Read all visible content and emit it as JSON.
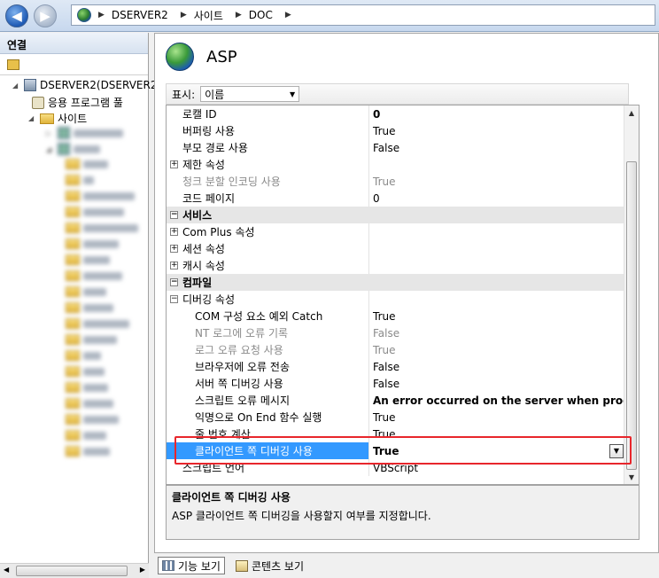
{
  "address": {
    "crumbs": [
      "DSERVER2",
      "사이트",
      "DOC"
    ],
    "icon": "iis-globe-icon"
  },
  "left": {
    "title": "연결",
    "tree": {
      "server": "DSERVER2(DSERVER2",
      "app_pools": "응용 프로그램 풀",
      "sites": "사이트"
    }
  },
  "page": {
    "title": "ASP",
    "filter_label": "표시:",
    "filter_value": "이름"
  },
  "grid": {
    "rows": [
      {
        "type": "prop",
        "indent": 0,
        "name": "로캘 ID",
        "value": "0",
        "value_bold": true
      },
      {
        "type": "prop",
        "indent": 0,
        "name": "버퍼링 사용",
        "value": "True"
      },
      {
        "type": "prop",
        "indent": 0,
        "name": "부모 경로 사용",
        "value": "False"
      },
      {
        "type": "group",
        "indent": 0,
        "name": "제한 속성",
        "value": ""
      },
      {
        "type": "prop",
        "indent": 0,
        "name": "청크 분할 인코딩 사용",
        "value": "True",
        "gray": true
      },
      {
        "type": "prop",
        "indent": 0,
        "name": "코드 페이지",
        "value": "0"
      },
      {
        "type": "category",
        "name": "서비스"
      },
      {
        "type": "group",
        "indent": 0,
        "name": "Com Plus 속성",
        "value": ""
      },
      {
        "type": "group",
        "indent": 0,
        "name": "세션 속성",
        "value": ""
      },
      {
        "type": "group",
        "indent": 0,
        "name": "캐시 속성",
        "value": ""
      },
      {
        "type": "category",
        "name": "컴파일"
      },
      {
        "type": "group-open",
        "indent": 0,
        "name": "디버깅 속성",
        "value": ""
      },
      {
        "type": "prop",
        "indent": 1,
        "name": "COM 구성 요소 예외 Catch",
        "value": "True"
      },
      {
        "type": "prop",
        "indent": 1,
        "name": "NT 로그에 오류 기록",
        "value": "False",
        "gray": true
      },
      {
        "type": "prop",
        "indent": 1,
        "name": "로그 오류 요청 사용",
        "value": "True",
        "gray": true
      },
      {
        "type": "prop",
        "indent": 1,
        "name": "브라우저에 오류 전송",
        "value": "False"
      },
      {
        "type": "prop",
        "indent": 1,
        "name": "서버 쪽 디버깅 사용",
        "value": "False"
      },
      {
        "type": "prop",
        "indent": 1,
        "name": "스크립트 오류 메시지",
        "value": "An error occurred on the server when processing",
        "value_bold": true
      },
      {
        "type": "prop",
        "indent": 1,
        "name": "익명으로 On End 함수 실행",
        "value": "True"
      },
      {
        "type": "prop",
        "indent": 1,
        "name": "줄 번호 계산",
        "value": "True"
      },
      {
        "type": "selected",
        "indent": 1,
        "name": "클라이언트 쪽 디버깅 사용",
        "value": "True"
      },
      {
        "type": "prop",
        "indent": 0,
        "name": "스크립트 언어",
        "value": "VBScript"
      }
    ]
  },
  "description": {
    "title": "클라이언트 쪽 디버깅 사용",
    "text": "ASP 클라이언트 쪽 디버깅을 사용할지 여부를 지정합니다."
  },
  "bottom": {
    "features_view": "기능 보기",
    "content_view": "콘텐츠 보기"
  },
  "colors": {
    "selection": "#3399ff",
    "highlight_border": "#e8262c",
    "category_bg": "#e6e6e6"
  }
}
